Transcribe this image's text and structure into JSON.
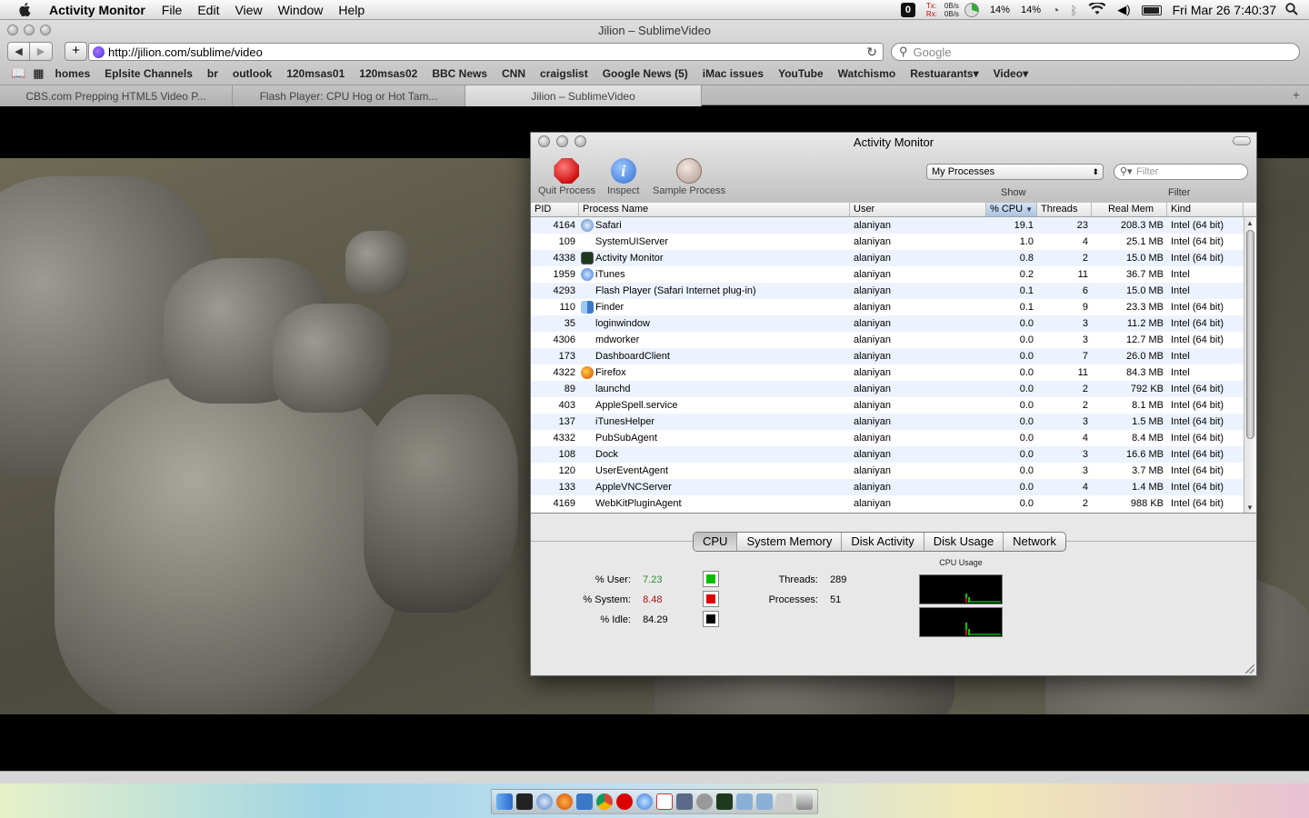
{
  "menubar": {
    "app_name": "Activity Monitor",
    "menus": [
      "File",
      "Edit",
      "View",
      "Window",
      "Help"
    ],
    "net_tx_label": "Tx:",
    "net_rx_label": "Rx:",
    "net_tx_value": "0B/s",
    "net_rx_value": "0B/s",
    "cpu1": "14%",
    "cpu2": "14%",
    "clock": "Fri Mar 26  7:40:37"
  },
  "safari": {
    "window_title": "Jilion – SublimeVideo",
    "url": "http://jilion.com/sublime/video",
    "search_placeholder": "Google",
    "bookmarks": [
      "homes",
      "Eplsite Channels",
      "br",
      "outlook",
      "120msas01",
      "120msas02",
      "BBC News",
      "CNN",
      "craigslist",
      "Google News (5)",
      "iMac issues",
      "YouTube",
      "Watchismo",
      "Restuarants▾",
      "Video▾"
    ],
    "tabs": [
      "CBS.com Prepping HTML5 Video P...",
      "Flash Player: CPU Hog or Hot Tam...",
      "Jilion – SublimeVideo"
    ],
    "new_tab_label": "+"
  },
  "activity_monitor": {
    "title": "Activity Monitor",
    "toolbar": {
      "quit_label": "Quit Process",
      "inspect_label": "Inspect",
      "sample_label": "Sample Process",
      "show_select": "My Processes",
      "filter_placeholder": "Filter",
      "show_label": "Show",
      "filter_label": "Filter"
    },
    "columns": [
      "PID",
      "Process Name",
      "User",
      "% CPU",
      "Threads",
      "Real Mem",
      "Kind"
    ],
    "sort_indicator": "▼",
    "processes": [
      {
        "pid": "4164",
        "name": "Safari",
        "user": "alaniyan",
        "cpu": "19.1",
        "threads": "23",
        "mem": "208.3 MB",
        "kind": "Intel (64 bit)",
        "icon": "safari-icon"
      },
      {
        "pid": "109",
        "name": "SystemUIServer",
        "user": "alaniyan",
        "cpu": "1.0",
        "threads": "4",
        "mem": "25.1 MB",
        "kind": "Intel (64 bit)",
        "icon": ""
      },
      {
        "pid": "4338",
        "name": "Activity Monitor",
        "user": "alaniyan",
        "cpu": "0.8",
        "threads": "2",
        "mem": "15.0 MB",
        "kind": "Intel (64 bit)",
        "icon": "activity-monitor-icon"
      },
      {
        "pid": "1959",
        "name": "iTunes",
        "user": "alaniyan",
        "cpu": "0.2",
        "threads": "11",
        "mem": "36.7 MB",
        "kind": "Intel",
        "icon": "itunes-icon"
      },
      {
        "pid": "4293",
        "name": "Flash Player (Safari Internet plug-in)",
        "user": "alaniyan",
        "cpu": "0.1",
        "threads": "6",
        "mem": "15.0 MB",
        "kind": "Intel",
        "icon": ""
      },
      {
        "pid": "110",
        "name": "Finder",
        "user": "alaniyan",
        "cpu": "0.1",
        "threads": "9",
        "mem": "23.3 MB",
        "kind": "Intel (64 bit)",
        "icon": "finder-icon"
      },
      {
        "pid": "35",
        "name": "loginwindow",
        "user": "alaniyan",
        "cpu": "0.0",
        "threads": "3",
        "mem": "11.2 MB",
        "kind": "Intel (64 bit)",
        "icon": ""
      },
      {
        "pid": "4306",
        "name": "mdworker",
        "user": "alaniyan",
        "cpu": "0.0",
        "threads": "3",
        "mem": "12.7 MB",
        "kind": "Intel (64 bit)",
        "icon": ""
      },
      {
        "pid": "173",
        "name": "DashboardClient",
        "user": "alaniyan",
        "cpu": "0.0",
        "threads": "7",
        "mem": "26.0 MB",
        "kind": "Intel",
        "icon": ""
      },
      {
        "pid": "4322",
        "name": "Firefox",
        "user": "alaniyan",
        "cpu": "0.0",
        "threads": "11",
        "mem": "84.3 MB",
        "kind": "Intel",
        "icon": "firefox-icon"
      },
      {
        "pid": "89",
        "name": "launchd",
        "user": "alaniyan",
        "cpu": "0.0",
        "threads": "2",
        "mem": "792 KB",
        "kind": "Intel (64 bit)",
        "icon": ""
      },
      {
        "pid": "403",
        "name": "AppleSpell.service",
        "user": "alaniyan",
        "cpu": "0.0",
        "threads": "2",
        "mem": "8.1 MB",
        "kind": "Intel (64 bit)",
        "icon": ""
      },
      {
        "pid": "137",
        "name": "iTunesHelper",
        "user": "alaniyan",
        "cpu": "0.0",
        "threads": "3",
        "mem": "1.5 MB",
        "kind": "Intel (64 bit)",
        "icon": ""
      },
      {
        "pid": "4332",
        "name": "PubSubAgent",
        "user": "alaniyan",
        "cpu": "0.0",
        "threads": "4",
        "mem": "8.4 MB",
        "kind": "Intel (64 bit)",
        "icon": ""
      },
      {
        "pid": "108",
        "name": "Dock",
        "user": "alaniyan",
        "cpu": "0.0",
        "threads": "3",
        "mem": "16.6 MB",
        "kind": "Intel (64 bit)",
        "icon": ""
      },
      {
        "pid": "120",
        "name": "UserEventAgent",
        "user": "alaniyan",
        "cpu": "0.0",
        "threads": "3",
        "mem": "3.7 MB",
        "kind": "Intel (64 bit)",
        "icon": ""
      },
      {
        "pid": "133",
        "name": "AppleVNCServer",
        "user": "alaniyan",
        "cpu": "0.0",
        "threads": "4",
        "mem": "1.4 MB",
        "kind": "Intel (64 bit)",
        "icon": ""
      },
      {
        "pid": "4169",
        "name": "WebKitPluginAgent",
        "user": "alaniyan",
        "cpu": "0.0",
        "threads": "2",
        "mem": "988 KB",
        "kind": "Intel (64 bit)",
        "icon": ""
      }
    ],
    "tabs": [
      "CPU",
      "System Memory",
      "Disk Activity",
      "Disk Usage",
      "Network"
    ],
    "active_tab": "CPU",
    "cpu_stats": {
      "user_label": "% User:",
      "user_value": "7.23",
      "user_color": "#00c000",
      "system_label": "% System:",
      "system_value": "8.48",
      "system_color": "#e00000",
      "idle_label": "% Idle:",
      "idle_value": "84.29",
      "idle_color": "#000000",
      "threads_label": "Threads:",
      "threads_value": "289",
      "processes_label": "Processes:",
      "processes_value": "51",
      "graph_title": "CPU Usage"
    }
  },
  "colors": {
    "user_value_text": "#2d8a2d",
    "system_value_text": "#b01010",
    "selection_blue": "#a9c3e3"
  }
}
